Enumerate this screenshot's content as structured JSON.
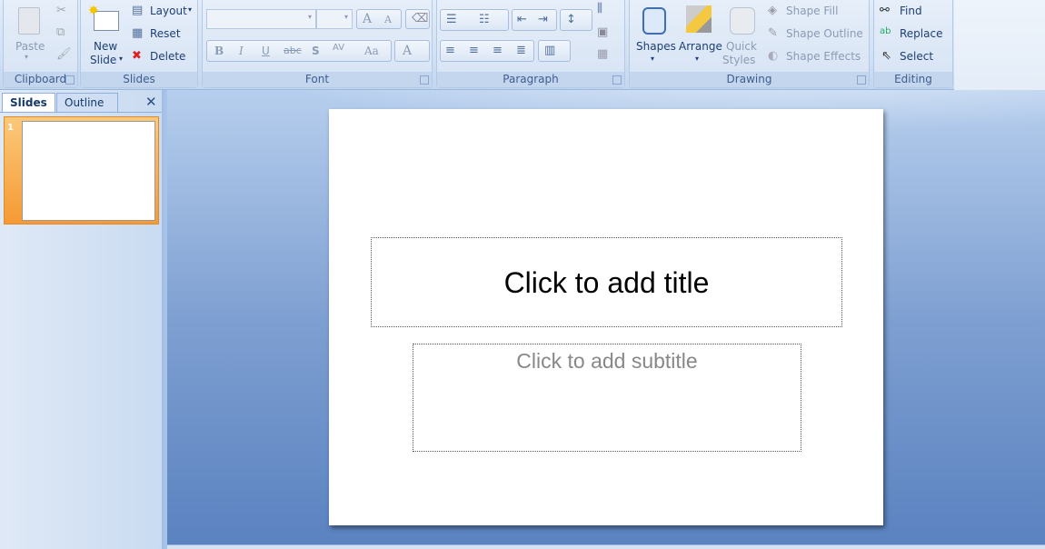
{
  "ribbon": {
    "clipboard": {
      "label": "Clipboard",
      "paste": "Paste"
    },
    "slides": {
      "label": "Slides",
      "new_slide_line1": "New",
      "new_slide_line2": "Slide",
      "layout": "Layout",
      "reset": "Reset",
      "delete": "Delete"
    },
    "font": {
      "label": "Font",
      "bold": "B",
      "italic": "I",
      "underline": "U",
      "strike": "abc",
      "shadow": "S",
      "spacing": "AV",
      "case": "Aa",
      "color": "A",
      "grow": "A",
      "shrink": "A"
    },
    "paragraph": {
      "label": "Paragraph"
    },
    "drawing": {
      "label": "Drawing",
      "shapes": "Shapes",
      "arrange": "Arrange",
      "quick_styles_line1": "Quick",
      "quick_styles_line2": "Styles",
      "shape_fill": "Shape Fill",
      "shape_outline": "Shape Outline",
      "shape_effects": "Shape Effects"
    },
    "editing": {
      "label": "Editing",
      "find": "Find",
      "replace": "Replace",
      "select": "Select"
    }
  },
  "panel": {
    "tabs": [
      "Slides",
      "Outline"
    ],
    "close": "✕",
    "slide_number": "1"
  },
  "slide": {
    "title_placeholder": "Click to add title",
    "subtitle_placeholder": "Click to add subtitle"
  }
}
